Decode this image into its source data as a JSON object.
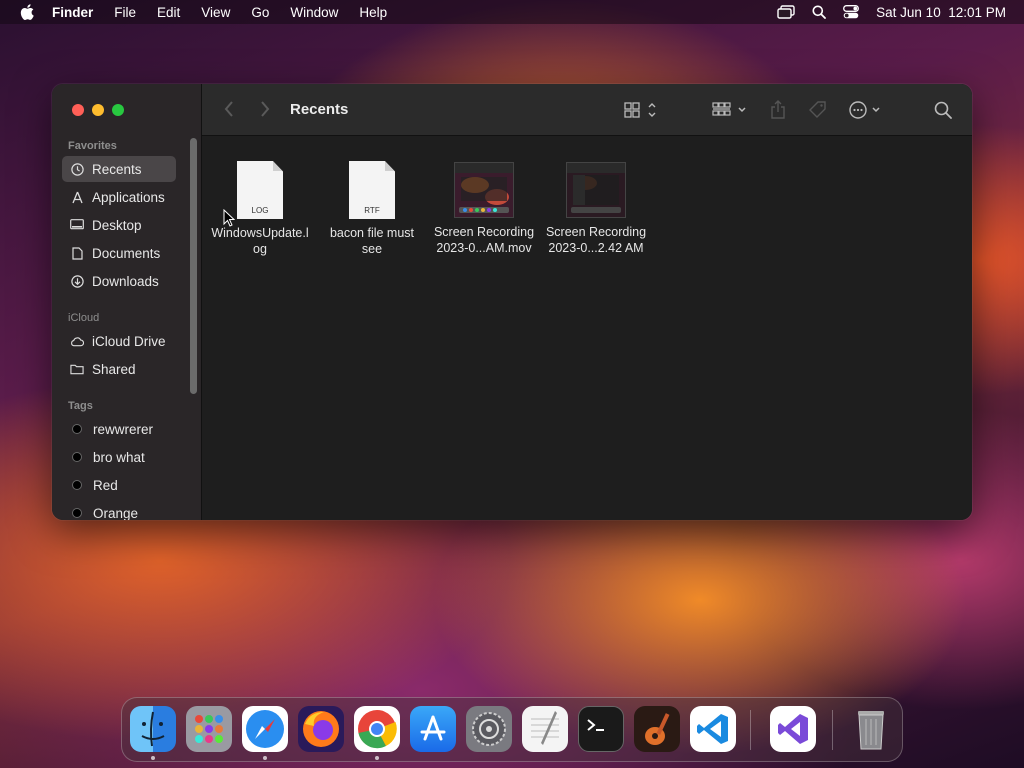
{
  "menubar": {
    "app_name": "Finder",
    "items": [
      "File",
      "Edit",
      "View",
      "Go",
      "Window",
      "Help"
    ],
    "clock": "Sat Jun 10  12:01 PM",
    "icons": [
      "apple-icon",
      "screen-mirroring-icon",
      "spotlight-search-icon",
      "control-center-icon"
    ]
  },
  "window": {
    "title": "Recents",
    "sidebar": {
      "favorites_label": "Favorites",
      "favorites": [
        {
          "label": "Recents",
          "icon": "clock-icon",
          "selected": true
        },
        {
          "label": "Applications",
          "icon": "applications-icon"
        },
        {
          "label": "Desktop",
          "icon": "desktop-icon"
        },
        {
          "label": "Documents",
          "icon": "document-icon"
        },
        {
          "label": "Downloads",
          "icon": "download-icon"
        }
      ],
      "icloud_label": "iCloud",
      "icloud": [
        {
          "label": "iCloud Drive",
          "icon": "cloud-icon"
        },
        {
          "label": "Shared",
          "icon": "shared-folder-icon"
        }
      ],
      "tags_label": "Tags",
      "tags": [
        {
          "label": "rewwrerer"
        },
        {
          "label": "bro what"
        },
        {
          "label": "Red"
        },
        {
          "label": "Orange"
        }
      ]
    },
    "files": [
      {
        "name_line1": "WindowsUpdate.l",
        "name_line2": "og",
        "type": "document",
        "ext": "LOG"
      },
      {
        "name_line1": "bacon file must",
        "name_line2": "see",
        "type": "document",
        "ext": "RTF"
      },
      {
        "name_line1": "Screen Recording",
        "name_line2": "2023-0...AM.mov",
        "type": "video"
      },
      {
        "name_line1": "Screen Recording",
        "name_line2": "2023-0...2.42 AM",
        "type": "video"
      }
    ]
  },
  "dock": {
    "apps": [
      "Finder",
      "Launchpad",
      "Safari",
      "Firefox",
      "Chrome",
      "App Store",
      "System Settings",
      "TextEdit",
      "Terminal",
      "GarageBand",
      "Visual Studio Code",
      "Visual Studio",
      "Trash"
    ]
  }
}
